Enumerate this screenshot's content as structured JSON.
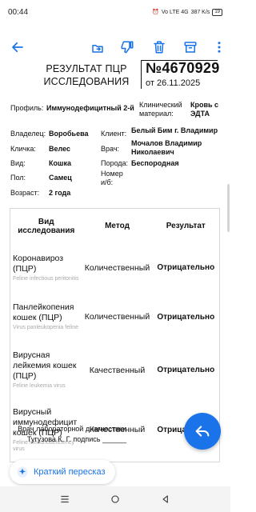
{
  "status_bar": {
    "time": "00:44",
    "network": "Vo LTE 4G",
    "speed": "387 K/s",
    "battery": "19"
  },
  "colors": {
    "accent": "#1a73e8"
  },
  "toolbar": {
    "icons": [
      "back-arrow-icon",
      "share-icon",
      "dislike-icon",
      "trash-icon",
      "archive-icon",
      "more-vert-icon"
    ]
  },
  "document": {
    "title": "РЕЗУЛЬТАТ ПЦР ИССЛЕДОВАНИЯ",
    "number": "№4670929",
    "date": "от 26.11.2025",
    "profile_label": "Профиль:",
    "profile_value": "Иммунодефицитный 2-й",
    "material_label": "Клинический материал:",
    "material_value": "Кровь с ЭДТА",
    "owner_label": "Владелец:",
    "owner_value": "Воробьева",
    "client_label": "Клиент:",
    "client_value": "Белый Бим г. Владимир",
    "nickname_label": "Кличка:",
    "nickname_value": "Велес",
    "doctor_label": "Врач:",
    "doctor_value": "Мочалов Владимир Николаевич",
    "species_label": "Вид:",
    "species_value": "Кошка",
    "breed_label": "Порода:",
    "breed_value": "Беспородная",
    "sex_label": "Пол:",
    "sex_value": "Самец",
    "number_label": "Номер и/б:",
    "number_value": "",
    "age_label": "Возраст:",
    "age_value": "2 года",
    "signature": "Врач лабораторной диагностики Тугузова К. Г. подпись ______"
  },
  "table": {
    "headers": [
      "Вид исследования",
      "Метод",
      "Результат"
    ],
    "rows": [
      {
        "name": "Коронавироз (ПЦР)",
        "latin": "Feline infectious peritonitis",
        "method": "Количественный",
        "result": "Отрицательно"
      },
      {
        "name": "Панлейкопения кошек (ПЦР)",
        "latin": "Virus panleukopenia feline",
        "method": "Количественный",
        "result": "Отрицательно"
      },
      {
        "name": "Вирусная лейкемия кошек (ПЦР)",
        "latin": "Feline leukemia virus",
        "method": "Качественный",
        "result": "Отрицательно"
      },
      {
        "name": "Вирусный иммунодефицит кошек (ПЦР)",
        "latin": "Feline immunodeficiency virus",
        "method": "Качественный",
        "result": "Отрицательно"
      }
    ]
  },
  "summary_button": {
    "label": "Краткий пересказ",
    "icon": "sparkle-icon"
  },
  "fab": {
    "icon": "reply-icon"
  },
  "nav": {
    "icons": [
      "menu-icon",
      "home-icon",
      "back-icon"
    ]
  }
}
